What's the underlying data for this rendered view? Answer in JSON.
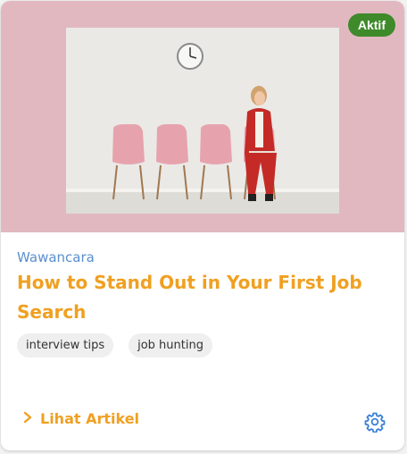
{
  "card": {
    "status_badge": "Aktif",
    "category": "Wawancara",
    "title": "How to Stand Out in Your First Job Search",
    "tags": [
      "interview tips",
      "job hunting"
    ],
    "cta_label": "Lihat Artikel",
    "image_icon": "waiting-room-photo",
    "cta_icon": "chevron-right-icon",
    "settings_icon": "gear-icon"
  },
  "colors": {
    "accent_orange": "#f0a021",
    "category_blue": "#5a8fcd",
    "badge_green": "#3f8a2b",
    "hero_pink": "#e2b8c0"
  }
}
